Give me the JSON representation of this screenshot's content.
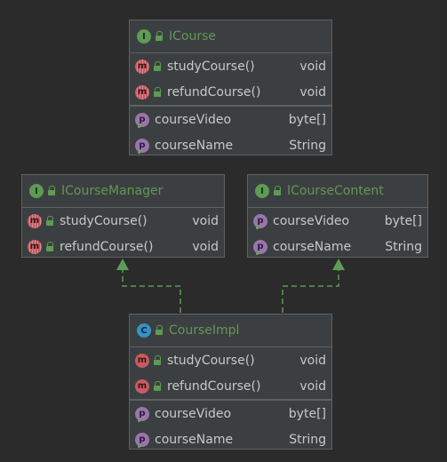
{
  "diagram": {
    "icourse": {
      "badge": "I",
      "name": "ICourse",
      "methods": [
        {
          "badge": "m",
          "name": "studyCourse()",
          "type": "void"
        },
        {
          "badge": "m",
          "name": "refundCourse()",
          "type": "void"
        }
      ],
      "fields": [
        {
          "badge": "p",
          "name": "courseVideo",
          "type": "byte[]"
        },
        {
          "badge": "p",
          "name": "courseName",
          "type": "String"
        }
      ]
    },
    "icourse_manager": {
      "badge": "I",
      "name": "ICourseManager",
      "methods": [
        {
          "badge": "m",
          "name": "studyCourse()",
          "type": "void"
        },
        {
          "badge": "m",
          "name": "refundCourse()",
          "type": "void"
        }
      ]
    },
    "icourse_content": {
      "badge": "I",
      "name": "ICourseContent",
      "fields": [
        {
          "badge": "p",
          "name": "courseVideo",
          "type": "byte[]"
        },
        {
          "badge": "p",
          "name": "courseName",
          "type": "String"
        }
      ]
    },
    "course_impl": {
      "badge": "C",
      "name": "CourseImpl",
      "methods": [
        {
          "badge": "m",
          "name": "studyCourse()",
          "type": "void"
        },
        {
          "badge": "m",
          "name": "refundCourse()",
          "type": "void"
        }
      ],
      "fields": [
        {
          "badge": "p",
          "name": "courseVideo",
          "type": "byte[]"
        },
        {
          "badge": "p",
          "name": "courseName",
          "type": "String"
        }
      ]
    }
  },
  "colors": {
    "background": "#2b2b2b",
    "node_fill": "#3c3f41",
    "interface_name": "#629755",
    "realization_line": "#5c9c54"
  }
}
